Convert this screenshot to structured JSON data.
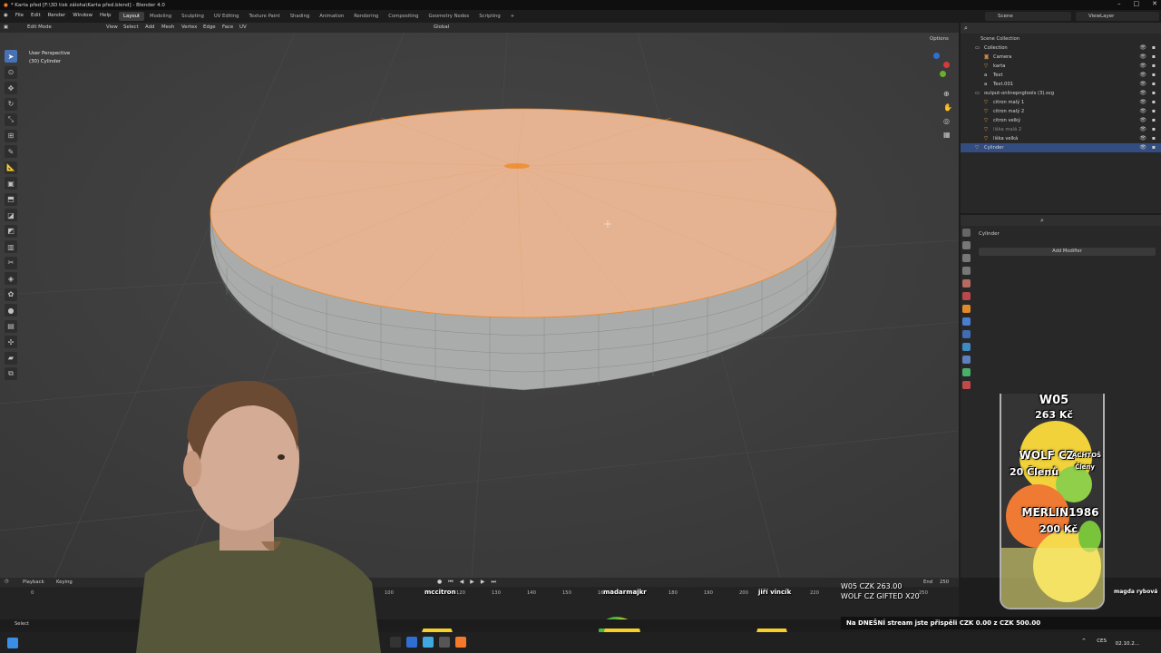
{
  "window": {
    "title": "* Karta před [F:\\3D tisk záloha\\Karta před.blend] - Blender 4.0",
    "buttons": [
      "–",
      "□",
      "✕"
    ]
  },
  "menu": [
    "File",
    "Edit",
    "Render",
    "Window",
    "Help"
  ],
  "workspaces": [
    "Layout",
    "Modeling",
    "Sculpting",
    "UV Editing",
    "Texture Paint",
    "Shading",
    "Animation",
    "Rendering",
    "Compositing",
    "Geometry Nodes",
    "Scripting",
    "+"
  ],
  "active_workspace": "Layout",
  "scene": "Scene",
  "view_layer": "ViewLayer",
  "viewport": {
    "mode": "Edit Mode",
    "header_menu": [
      "View",
      "Select",
      "Add",
      "Mesh",
      "Vertex",
      "Edge",
      "Face",
      "UV"
    ],
    "transform": "Global",
    "options": "Options",
    "perspective": "User Perspective",
    "object_label": "(30) Cylinder"
  },
  "outliner": {
    "root": "Scene Collection",
    "items": [
      {
        "label": "Collection",
        "indent": 1,
        "icon": "collection-icon",
        "selected": false,
        "muted": false
      },
      {
        "label": "Camera",
        "indent": 2,
        "icon": "camera-icon",
        "selected": false,
        "muted": false
      },
      {
        "label": "karta",
        "indent": 2,
        "icon": "mesh-icon",
        "selected": false,
        "muted": false
      },
      {
        "label": "Text",
        "indent": 2,
        "icon": "text-icon",
        "selected": false,
        "muted": false
      },
      {
        "label": "Text.001",
        "indent": 2,
        "icon": "text-icon",
        "selected": false,
        "muted": false
      },
      {
        "label": "output-onlinepngtools (3).svg",
        "indent": 1,
        "icon": "collection-icon",
        "selected": false,
        "muted": false
      },
      {
        "label": "citron malý 1",
        "indent": 2,
        "icon": "curve-icon",
        "selected": false,
        "muted": false
      },
      {
        "label": "citron malý 2",
        "indent": 2,
        "icon": "curve-icon",
        "selected": false,
        "muted": false
      },
      {
        "label": "citron velký",
        "indent": 2,
        "icon": "curve-icon",
        "selected": false,
        "muted": false
      },
      {
        "label": "liška malá 2",
        "indent": 2,
        "icon": "curve-icon",
        "selected": false,
        "muted": true
      },
      {
        "label": "liška velká",
        "indent": 2,
        "icon": "curve-icon",
        "selected": false,
        "muted": false
      },
      {
        "label": "Cylinder",
        "indent": 1,
        "icon": "mesh-icon",
        "selected": true,
        "muted": false
      }
    ]
  },
  "properties": {
    "object_name": "Cylinder",
    "add_modifier": "Add Modifier"
  },
  "timeline": {
    "playback": "Playback",
    "keying": "Keying",
    "end_label": "End",
    "end_value": "250",
    "ticks": [
      "0",
      "100",
      "120",
      "130",
      "140",
      "150",
      "160",
      "170",
      "180",
      "190",
      "200",
      "220",
      "250"
    ]
  },
  "status": {
    "left": "Select"
  },
  "overlay": {
    "glass": {
      "lines": [
        {
          "text": "W05",
          "size": 13
        },
        {
          "text": "263 Kč",
          "size": 11
        },
        {
          "text": "WOLF CZ",
          "size": 12
        },
        {
          "text": "ACHTOŠ",
          "size": 7
        },
        {
          "text": "Členy",
          "size": 7
        },
        {
          "text": "20 Členů",
          "size": 11
        },
        {
          "text": "MERLIN1986",
          "size": 12
        },
        {
          "text": "200 Kč",
          "size": 11
        }
      ]
    },
    "donations": [
      "W05   CZK 263.00",
      "WOLF CZ   GIFTED X20"
    ],
    "stream_message": "Na DNEŠNÍ stream jste přispěli CZK 0.00 z CZK 500.00",
    "chat_names": [
      "mccitron",
      "madarmajkr",
      "jiří vincík",
      "magda rybová"
    ]
  },
  "taskbar": {
    "tray": [
      "^",
      "CES"
    ],
    "clock": "02.10.2..."
  },
  "colors": {
    "mesh_top": "#e8b48c",
    "mesh_side": "#a9acab",
    "selection": "#334d80",
    "accent": "#4772b3",
    "edge": "#f08a24"
  }
}
